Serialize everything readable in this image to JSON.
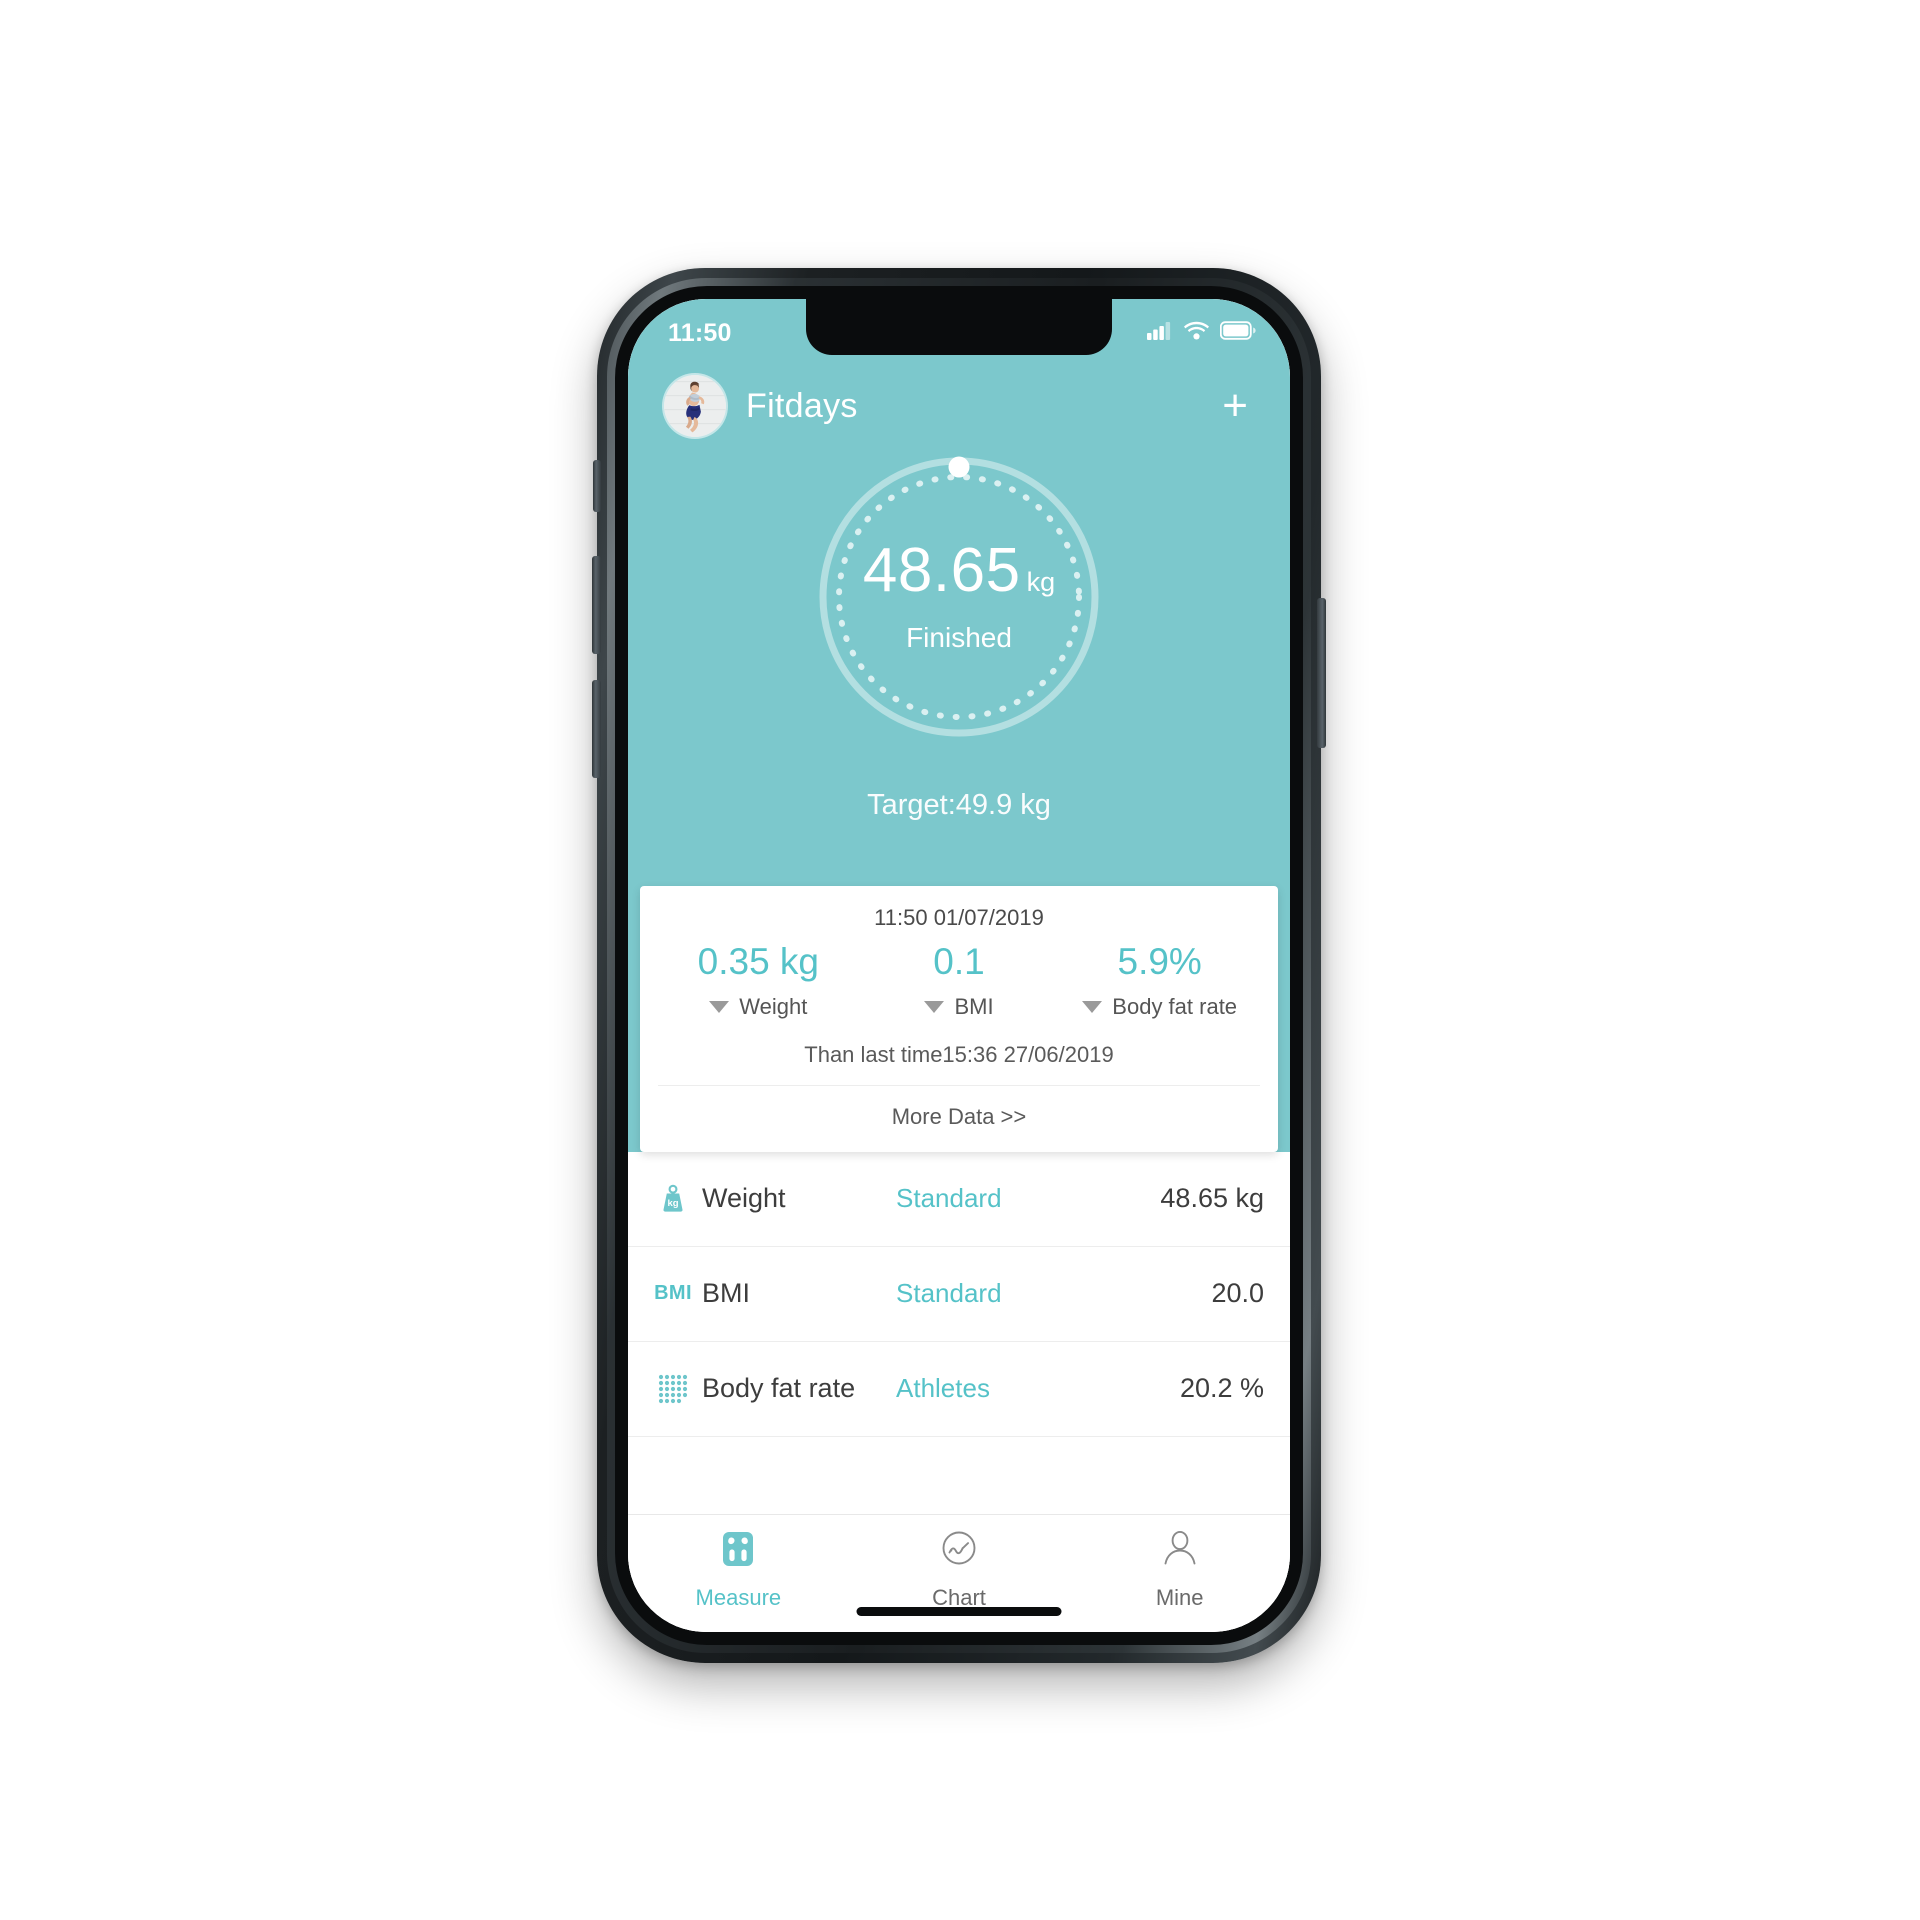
{
  "status_bar": {
    "time": "11:50",
    "icons": [
      "signal-bars-icon",
      "wifi-icon",
      "battery-icon"
    ]
  },
  "header": {
    "avatar_alt": "user-avatar-running-woman",
    "title": "Fitdays",
    "add_label": "+"
  },
  "gauge": {
    "value": "48.65",
    "unit": "kg",
    "status": "Finished",
    "target": "Target:49.9 kg"
  },
  "summary_card": {
    "date": "11:50 01/07/2019",
    "deltas": [
      {
        "value": "0.35 kg",
        "label": "Weight",
        "direction": "down"
      },
      {
        "value": "0.1",
        "label": "BMI",
        "direction": "down"
      },
      {
        "value": "5.9%",
        "label": "Body fat rate",
        "direction": "down"
      }
    ],
    "note": "Than last time15:36 27/06/2019",
    "more_data": "More Data >>"
  },
  "metrics": [
    {
      "icon": "weight-scale-kg-icon",
      "name": "Weight",
      "status": "Standard",
      "value": "48.65 kg"
    },
    {
      "icon": "bmi-text-icon",
      "icon_text": "BMI",
      "name": "BMI",
      "status": "Standard",
      "value": "20.0"
    },
    {
      "icon": "body-fat-dots-icon",
      "name": "Body fat rate",
      "status": "Athletes",
      "value": "20.2 %"
    }
  ],
  "tabs": [
    {
      "label": "Measure",
      "icon": "body-scale-icon",
      "active": true
    },
    {
      "label": "Chart",
      "icon": "chart-trend-circle-icon",
      "active": false
    },
    {
      "label": "Mine",
      "icon": "person-icon",
      "active": false
    }
  ],
  "colors": {
    "teal_bg": "#7cc8cc",
    "accent": "#55c2c8",
    "text_dark": "#3d3d3d",
    "text_muted": "#6a6a6a",
    "card_bg": "#ffffff"
  }
}
